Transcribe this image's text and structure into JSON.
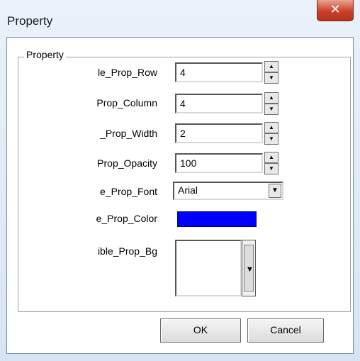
{
  "window": {
    "title": "Property",
    "close_glyph": "✕"
  },
  "group": {
    "label": "Property"
  },
  "rows": [
    {
      "label": "le_Prop_Row",
      "value": "4"
    },
    {
      "label": "Prop_Column",
      "value": "4"
    },
    {
      "label": "_Prop_Width",
      "value": "2"
    },
    {
      "label": "Prop_Opacity",
      "value": "100"
    },
    {
      "label": "e_Prop_Font",
      "value": "Arial"
    },
    {
      "label": "e_Prop_Color",
      "color": "#0000ff"
    },
    {
      "label": "ible_Prop_Bg"
    }
  ],
  "spin": {
    "up": "▲",
    "down": "▼"
  },
  "dropdown_arrow": "▼",
  "scroll_arrow": "▼",
  "buttons": {
    "ok": "OK",
    "cancel": "Cancel"
  }
}
